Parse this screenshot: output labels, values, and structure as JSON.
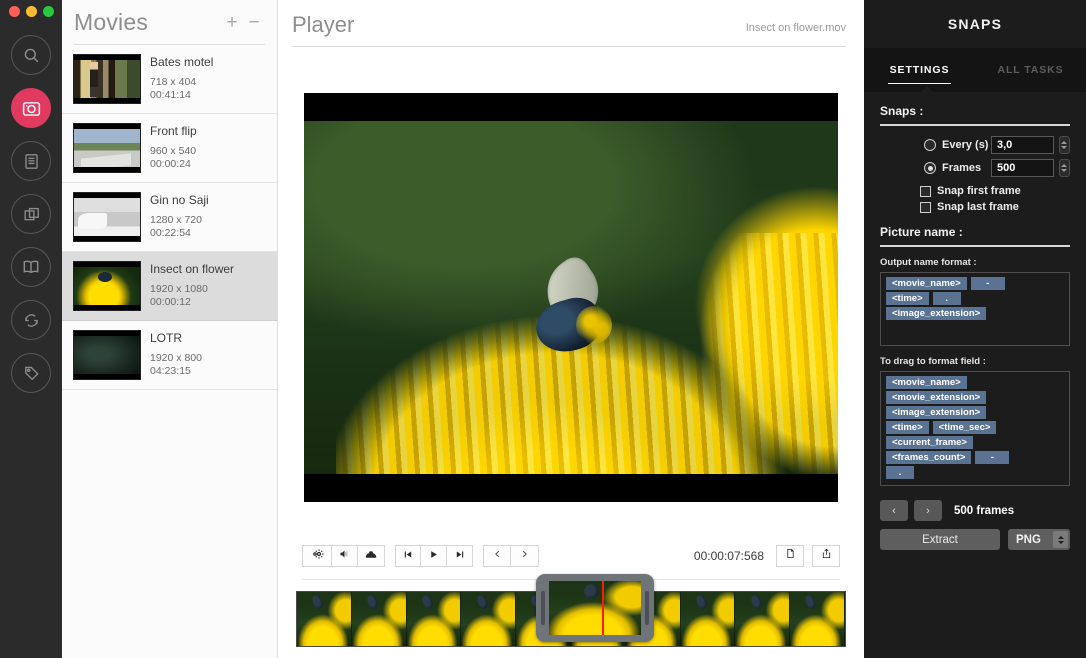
{
  "window": {
    "traffic_lights": [
      "close",
      "minimize",
      "zoom"
    ],
    "colors": {
      "accent": "#e03a5f",
      "panel_dark": "#1c1c1c",
      "token_blue": "#5b7392",
      "playhead_red": "#ff1a00"
    }
  },
  "rail": {
    "items": [
      {
        "name": "search-icon",
        "active": false
      },
      {
        "name": "camera-icon",
        "active": true
      },
      {
        "name": "list-icon",
        "active": false
      },
      {
        "name": "layers-icon",
        "active": false
      },
      {
        "name": "book-icon",
        "active": false
      },
      {
        "name": "sync-icon",
        "active": false
      },
      {
        "name": "tag-icon",
        "active": false
      }
    ]
  },
  "movies": {
    "title": "Movies",
    "add_label": "+",
    "remove_label": "−",
    "items": [
      {
        "name": "Bates motel",
        "resolution": "718 x 404",
        "duration": "00:41:14",
        "selected": false,
        "thumb": "th-bates"
      },
      {
        "name": "Front flip",
        "resolution": "960 x 540",
        "duration": "00:00:24",
        "selected": false,
        "thumb": "th-front"
      },
      {
        "name": "Gin no Saji",
        "resolution": "1280 x 720",
        "duration": "00:22:54",
        "selected": false,
        "thumb": "th-gin"
      },
      {
        "name": "Insect on flower",
        "resolution": "1920 x 1080",
        "duration": "00:00:12",
        "selected": true,
        "thumb": "th-insect"
      },
      {
        "name": "LOTR",
        "resolution": "1920 x 800",
        "duration": "04:23:15",
        "selected": false,
        "thumb": "th-lotr"
      }
    ]
  },
  "player": {
    "title": "Player",
    "filename": "Insect on flower.mov",
    "timecode": "00:00:07:568",
    "controls": {
      "settings_icon": "gear-icon",
      "volume_icon": "speaker-icon",
      "subtitles_icon": "subtitles-icon",
      "prev_frame_icon": "skip-start-icon",
      "play_icon": "play-icon",
      "next_frame_icon": "skip-end-icon",
      "step_back_icon": "chevron-left-icon",
      "step_forward_icon": "chevron-right-icon",
      "snapshot_icon": "document-icon",
      "share_icon": "share-icon"
    }
  },
  "snaps": {
    "title": "SNAPS",
    "tabs": [
      {
        "label": "SETTINGS",
        "active": true
      },
      {
        "label": "ALL TASKS",
        "active": false
      }
    ],
    "snaps_section": {
      "heading": "Snaps :",
      "every_label": "Every (s)",
      "every_value": "3,0",
      "every_selected": false,
      "frames_label": "Frames",
      "frames_value": "500",
      "frames_selected": true,
      "snap_first_label": "Snap first frame",
      "snap_first_checked": false,
      "snap_last_label": "Snap last frame",
      "snap_last_checked": false
    },
    "picture_name_section": {
      "heading": "Picture name :",
      "output_label": "Output name format :",
      "output_tokens": [
        [
          "<movie_name>",
          "-"
        ],
        [
          "<time>",
          "."
        ],
        [
          "<image_extension>"
        ]
      ],
      "drag_label": "To drag to format field :",
      "drag_tokens": [
        [
          "<movie_name>"
        ],
        [
          "<movie_extension>"
        ],
        [
          "<image_extension>"
        ],
        [
          "<time>",
          "<time_sec>"
        ],
        [
          "<current_frame>"
        ],
        [
          "<frames_count>",
          "-"
        ],
        [
          "."
        ]
      ]
    },
    "footer": {
      "prev_label": "‹",
      "next_label": "›",
      "frames_count": "500 frames",
      "extract_label": "Extract",
      "format_value": "PNG"
    }
  }
}
